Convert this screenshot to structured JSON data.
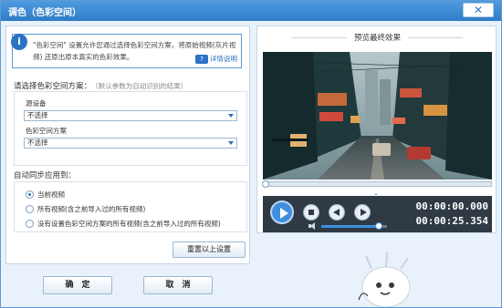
{
  "window": {
    "title": "调色（色彩空间）",
    "close_label": "✕"
  },
  "info": {
    "text": "\"色彩空间\" 设置允许您通过选择色彩空间方案，将原始视频(灰片视频) 还原出原本真实的色彩效果。",
    "help_link": "详情说明",
    "help_badge": "?"
  },
  "color_space": {
    "label": "请选择色彩空间方案：",
    "hint": "（默认参数为自动识别的结果）",
    "source_device_label": "源设备",
    "source_device_value": "不选择",
    "scheme_label": "色彩空间方案",
    "scheme_value": "不选择"
  },
  "auto_sync": {
    "label": "自动同步应用到：",
    "options": [
      {
        "label": "当前视频",
        "selected": true
      },
      {
        "label": "所有视频(含之前导入过的所有视频)",
        "selected": false
      },
      {
        "label": "没有设置色彩空间方案的所有视频(含之前导入过的所有视频)",
        "selected": false
      }
    ],
    "reset_label": "重置以上设置"
  },
  "footer": {
    "ok_label": "确　定",
    "cancel_label": "取　消"
  },
  "preview": {
    "title": "预览最终效果",
    "collapse_icon": "chevron-down-icon",
    "progress": 0.0,
    "volume": 0.88,
    "time_current": "00:00:00.000",
    "time_total": "00:00:25.354"
  },
  "colors": {
    "accent": "#2a72c4",
    "titlebar": "#3a87d3",
    "player_bg": "#2f3a45"
  }
}
